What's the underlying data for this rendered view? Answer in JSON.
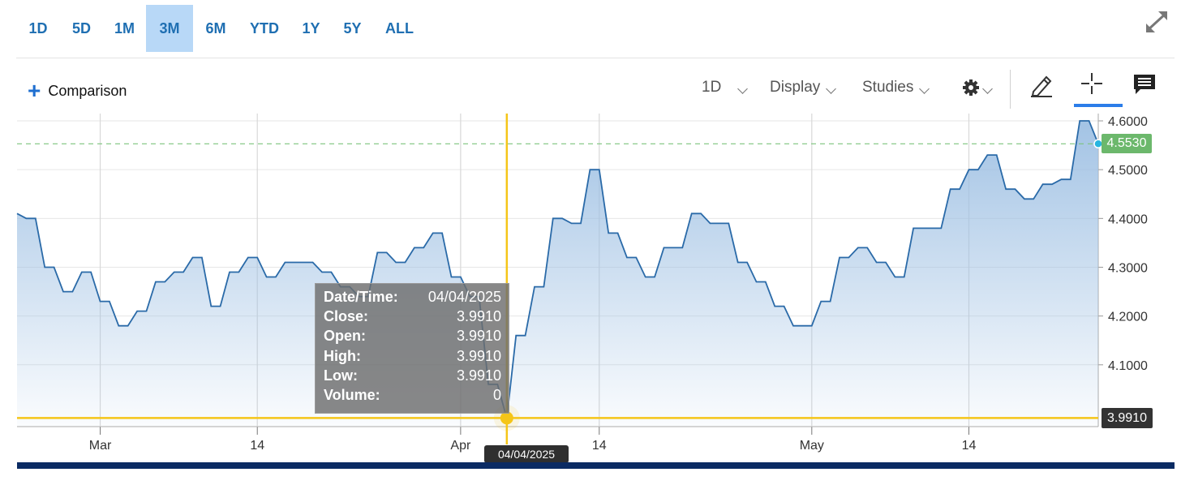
{
  "range_buttons": [
    {
      "label": "1D",
      "name": "range-1d"
    },
    {
      "label": "5D",
      "name": "range-5d"
    },
    {
      "label": "1M",
      "name": "range-1m"
    },
    {
      "label": "3M",
      "name": "range-3m",
      "active": true
    },
    {
      "label": "6M",
      "name": "range-6m"
    },
    {
      "label": "YTD",
      "name": "range-ytd"
    },
    {
      "label": "1Y",
      "name": "range-1y"
    },
    {
      "label": "5Y",
      "name": "range-5y"
    },
    {
      "label": "ALL",
      "name": "range-all"
    }
  ],
  "toolbar": {
    "comparison_label": "Comparison",
    "interval_label": "1D",
    "display_label": "Display",
    "studies_label": "Studies"
  },
  "colors": {
    "accent": "#1f6fb2",
    "line": "#2a6aa8",
    "crosshair": "#f5c518",
    "last_price": "#6cb86c",
    "bottom_bar": "#0b2b63"
  },
  "tooltip": {
    "rows": [
      {
        "key": "Date/Time:",
        "value": "04/04/2025"
      },
      {
        "key": "Close:",
        "value": "3.9910"
      },
      {
        "key": "Open:",
        "value": "3.9910"
      },
      {
        "key": "High:",
        "value": "3.9910"
      },
      {
        "key": "Low:",
        "value": "3.9910"
      },
      {
        "key": "Volume:",
        "value": "0"
      }
    ]
  },
  "crosshair": {
    "date_label": "04/04/2025",
    "value": 3.991,
    "value_label": "3.9910",
    "x_index": 53
  },
  "last_price": {
    "value": 4.553,
    "label": "4.5530"
  },
  "chart_data": {
    "type": "area",
    "x_tick_labels": [
      {
        "label": "Mar",
        "index": 9
      },
      {
        "label": "14",
        "index": 26
      },
      {
        "label": "Apr",
        "index": 48
      },
      {
        "label": "14",
        "index": 63
      },
      {
        "label": "May",
        "index": 86
      },
      {
        "label": "14",
        "index": 103
      }
    ],
    "y_ticks": [
      "4.1000",
      "4.2000",
      "4.3000",
      "4.4000",
      "4.5000",
      "4.6000"
    ],
    "ylim": [
      3.975,
      4.615
    ],
    "grid": true,
    "values": [
      4.41,
      4.4,
      4.4,
      4.3,
      4.3,
      4.25,
      4.25,
      4.29,
      4.29,
      4.23,
      4.23,
      4.18,
      4.18,
      4.21,
      4.21,
      4.27,
      4.27,
      4.29,
      4.29,
      4.32,
      4.32,
      4.22,
      4.22,
      4.29,
      4.29,
      4.32,
      4.32,
      4.28,
      4.28,
      4.31,
      4.31,
      4.31,
      4.31,
      4.29,
      4.29,
      4.26,
      4.26,
      4.24,
      4.24,
      4.33,
      4.33,
      4.31,
      4.31,
      4.34,
      4.34,
      4.37,
      4.37,
      4.28,
      4.28,
      4.24,
      4.24,
      4.06,
      4.06,
      3.99,
      4.16,
      4.16,
      4.26,
      4.26,
      4.4,
      4.4,
      4.39,
      4.39,
      4.5,
      4.5,
      4.37,
      4.37,
      4.32,
      4.32,
      4.28,
      4.28,
      4.34,
      4.34,
      4.34,
      4.41,
      4.41,
      4.39,
      4.39,
      4.39,
      4.31,
      4.31,
      4.27,
      4.27,
      4.22,
      4.22,
      4.18,
      4.18,
      4.18,
      4.23,
      4.23,
      4.32,
      4.32,
      4.34,
      4.34,
      4.31,
      4.31,
      4.28,
      4.28,
      4.38,
      4.38,
      4.38,
      4.38,
      4.46,
      4.46,
      4.5,
      4.5,
      4.53,
      4.53,
      4.46,
      4.46,
      4.44,
      4.44,
      4.47,
      4.47,
      4.48,
      4.48,
      4.6,
      4.6,
      4.553
    ]
  }
}
